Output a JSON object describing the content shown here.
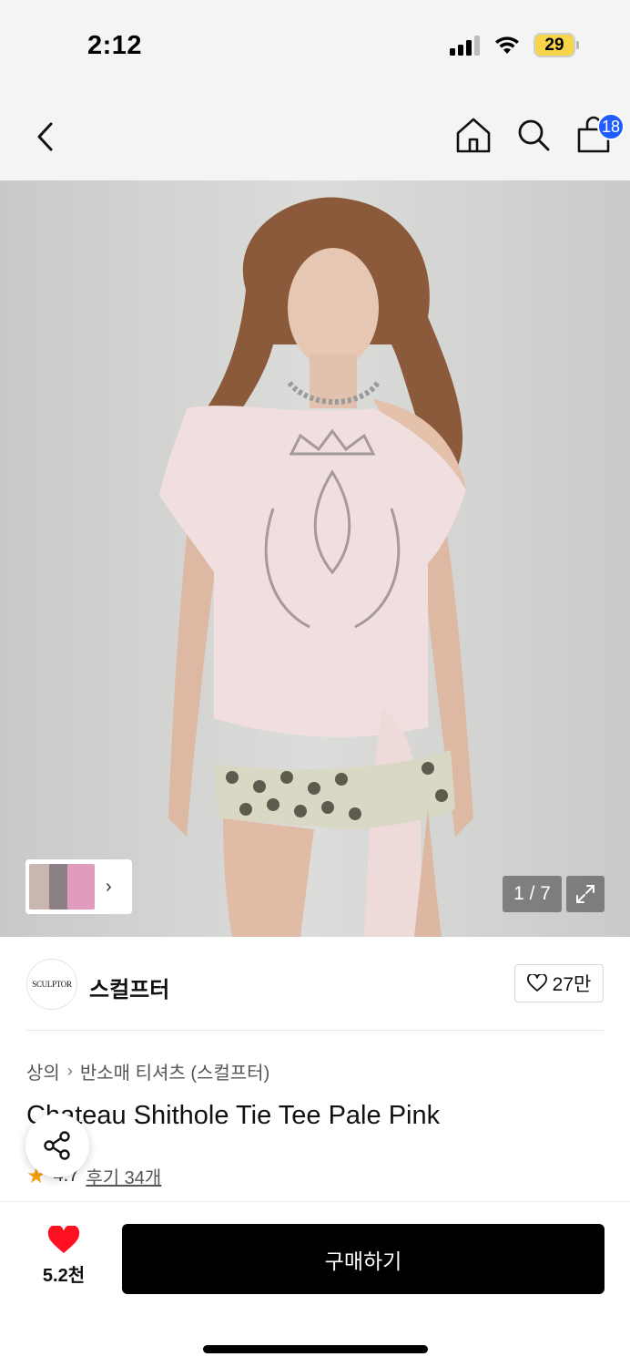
{
  "status_bar": {
    "time": "2:12",
    "battery": "29"
  },
  "header": {
    "cart_count": "18",
    "icons": [
      "back-icon",
      "home-icon",
      "search-icon",
      "cart-icon"
    ]
  },
  "gallery": {
    "page_indicator": "1 / 7",
    "thumbnail_arrow": "›"
  },
  "brand": {
    "logo_text": "SCULPTOR",
    "name": "스컬프터",
    "likes": "27만"
  },
  "breadcrumb": {
    "level1": "상의",
    "separator": "›",
    "level2": "반소매 티셔츠 (스컬프터)"
  },
  "product": {
    "title": "Chateau Shithole Tie Tee Pale Pink",
    "rating": "4.7",
    "reviews": "후기 34개"
  },
  "bottom_bar": {
    "wish_count": "5.2천",
    "buy_label": "구매하기"
  },
  "colors": {
    "accent_blue": "#1f5dff",
    "heart_red": "#ff0f1f",
    "star_orange": "#f6a10d",
    "button_black": "#000000"
  }
}
